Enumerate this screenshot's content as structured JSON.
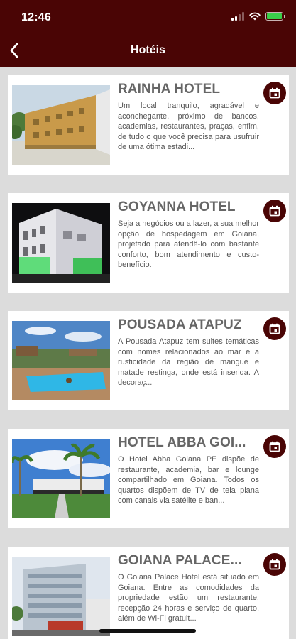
{
  "status_bar": {
    "time": "12:46"
  },
  "nav": {
    "title": "Hotéis"
  },
  "colors": {
    "primary": "#4a0505",
    "background": "#dcdcdc",
    "card": "#ffffff"
  },
  "hotels": [
    {
      "name": "RAINHA HOTEL",
      "description": "Um local tranquilo, agradável e aconchegante, próximo de bancos, academias, restaurantes, praças, enfim, de tudo o que você precisa para usufruir de uma ótima estadi...",
      "icon": "calendar-icon"
    },
    {
      "name": "GOYANNA HOTEL",
      "description": "Seja a negócios ou a lazer, a sua melhor opção de hospedagem em Goiana, projetado para atendê-lo com bastante conforto, bom atendimento e custo-benefício.",
      "icon": "calendar-icon"
    },
    {
      "name": "POUSADA ATAPUZ",
      "description": "A Pousada Atapuz tem suites temáticas com nomes relacionados ao mar e a rusticidade da região de mangue e matade restinga, onde está inserida. A decoraç...",
      "icon": "calendar-icon"
    },
    {
      "name": "HOTEL ABBA GOI...",
      "description": "O Hotel Abba Goiana PE dispõe de restaurante, academia, bar e lounge compartilhado em Goiana. Todos os quartos dispõem de TV de tela plana com canais via satélite e ban...",
      "icon": "calendar-icon"
    },
    {
      "name": "GOIANA PALACE...",
      "description": "O Goiana Palace Hotel está situado em Goiana. Entre as comodidades da propriedade estão um restaurante, recepção 24 horas e serviço de quarto, além de Wi-Fi gratuit...",
      "icon": "calendar-icon"
    }
  ]
}
